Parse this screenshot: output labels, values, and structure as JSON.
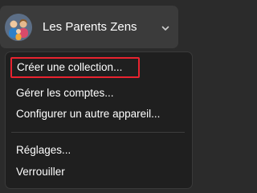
{
  "header": {
    "account_name": "Les Parents Zens",
    "avatar_icon": "family-avatar-icon",
    "chevron_icon": "chevron-down-icon"
  },
  "menu": {
    "items": [
      {
        "label": "Créer une collection...",
        "highlighted": true
      },
      {
        "label": "Gérer les comptes..."
      },
      {
        "label": "Configurer un autre appareil..."
      },
      {
        "label": "Réglages..."
      },
      {
        "label": "Verrouiller"
      }
    ],
    "highlight_color": "#e8232f"
  }
}
